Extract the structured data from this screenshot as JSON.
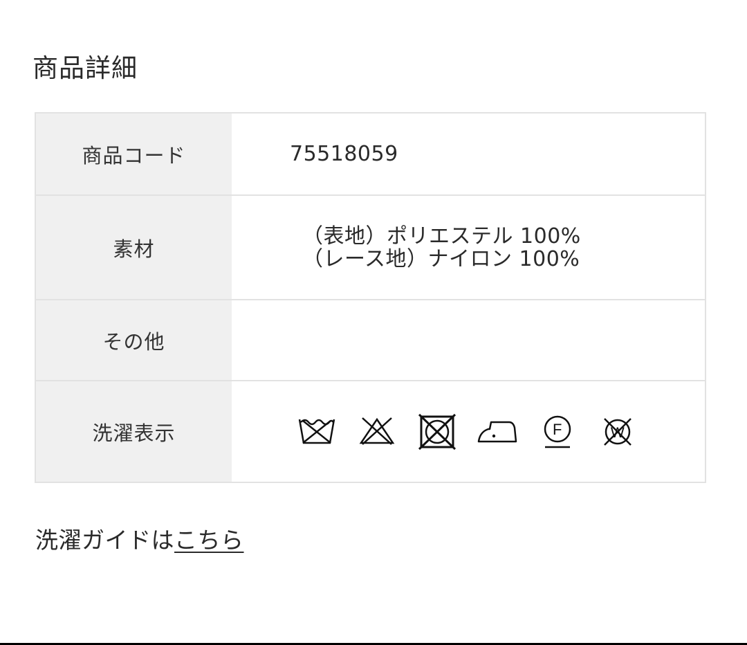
{
  "section_title": "商品詳細",
  "rows": [
    {
      "label": "商品コード",
      "value": "75518059"
    },
    {
      "label": "素材",
      "lines": [
        "（表地）ポリエステル 100%",
        "（レース地）ナイロン 100%"
      ]
    },
    {
      "label": "その他",
      "value": ""
    },
    {
      "label": "洗濯表示",
      "icons": [
        "hand-wash-40-icon",
        "no-bleach-icon",
        "no-tumble-dry-icon",
        "iron-low-temp-icon",
        "dry-clean-f-icon",
        "no-wet-clean-icon"
      ]
    }
  ],
  "guide": {
    "prefix": "洗濯ガイドは",
    "link_text": "こちら"
  }
}
